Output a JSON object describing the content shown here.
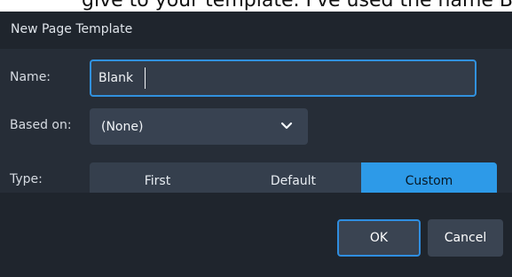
{
  "background_text": "give to your template. I've used the name Bl",
  "dialog": {
    "title": "New Page Template",
    "fields": {
      "name_label": "Name:",
      "name_value": "Blank",
      "based_on_label": "Based on:",
      "based_on_value": "(None)",
      "type_label": "Type:"
    },
    "type_options": [
      {
        "label": "First",
        "selected": false
      },
      {
        "label": "Default",
        "selected": false
      },
      {
        "label": "Custom",
        "selected": true
      }
    ],
    "buttons": {
      "ok": "OK",
      "cancel": "Cancel"
    },
    "icons": {
      "dropdown": "chevron-down-icon"
    },
    "colors": {
      "accent": "#2d9ae8",
      "dialog_background": "#262d37",
      "footer_background": "#1f252d"
    }
  }
}
